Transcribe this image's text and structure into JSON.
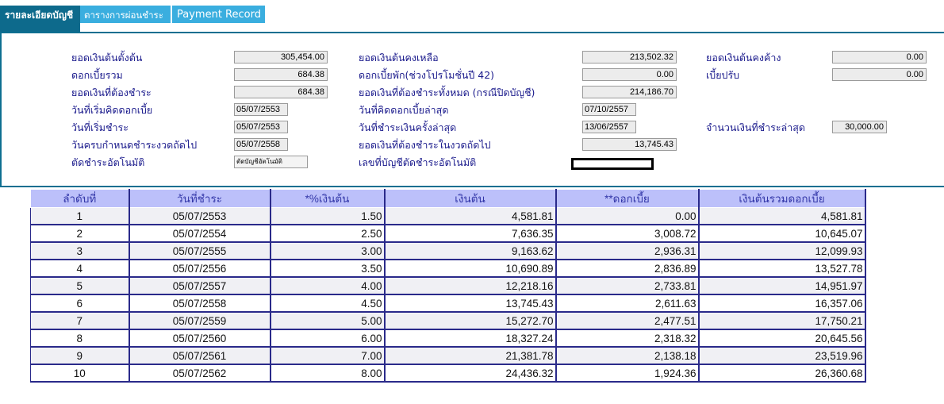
{
  "tabs": [
    {
      "label": "รายละเอียดบัญชี"
    },
    {
      "label": "ตารางการผ่อนชำระ"
    },
    {
      "label": "Payment Record"
    }
  ],
  "details": {
    "principal_start_label": "ยอดเงินต้นตั้งต้น",
    "principal_start_value": "305,454.00",
    "principal_remaining_label": "ยอดเงินต้นคงเหลือ",
    "principal_remaining_value": "213,502.32",
    "principal_overdue_label": "ยอดเงินต้นคงค้าง",
    "principal_overdue_value": "0.00",
    "interest_total_label": "ดอกเบี้ยรวม",
    "interest_total_value": "684.38",
    "interest_suspended_label": "ดอกเบี้ยพัก(ช่วงโปรโมชั่นปี 42)",
    "interest_suspended_value": "0.00",
    "penalty_label": "เบี้ยปรับ",
    "penalty_value": "0.00",
    "amount_due_label": "ยอดเงินที่ต้องชำระ",
    "amount_due_value": "684.38",
    "total_payoff_label": "ยอดเงินที่ต้องชำระทั้งหมด (กรณีปิดบัญชี)",
    "total_payoff_value": "214,186.70",
    "interest_start_date_label": "วันที่เริ่มคิดดอกเบี้ย",
    "interest_start_date_value": "05/07/2553",
    "last_interest_date_label": "วันที่คิดดอกเบี้ยล่าสุด",
    "last_interest_date_value": "07/10/2557",
    "payment_start_date_label": "วันที่เริ่มชำระ",
    "payment_start_date_value": "05/07/2553",
    "last_payment_date_label": "วันที่ชำระเงินครั้งล่าสุด",
    "last_payment_date_value": "13/06/2557",
    "last_payment_amount_label": "จำนวนเงินที่ชำระล่าสุด",
    "last_payment_amount_value": "30,000.00",
    "next_due_date_label": "วันครบกำหนดชำระงวดถัดไป",
    "next_due_date_value": "05/07/2558",
    "next_installment_label": "ยอดเงินที่ต้องชำระในงวดถัดไป",
    "next_installment_value": "13,745.43",
    "auto_debit_label": "ตัดชำระอัตโนมัติ",
    "auto_debit_value": "ตัดบัญชีอัตโนมัติ",
    "auto_debit_account_label": "เลขที่บัญชีตัดชำระอัตโนมัติ"
  },
  "schedule": {
    "headers": [
      "ลำดับที่",
      "วันที่ชำระ",
      "*%เงินต้น",
      "เงินต้น",
      "**ดอกเบี้ย",
      "เงินต้นรวมดอกเบี้ย"
    ],
    "rows": [
      [
        "1",
        "05/07/2553",
        "1.50",
        "4,581.81",
        "0.00",
        "4,581.81"
      ],
      [
        "2",
        "05/07/2554",
        "2.50",
        "7,636.35",
        "3,008.72",
        "10,645.07"
      ],
      [
        "3",
        "05/07/2555",
        "3.00",
        "9,163.62",
        "2,936.31",
        "12,099.93"
      ],
      [
        "4",
        "05/07/2556",
        "3.50",
        "10,690.89",
        "2,836.89",
        "13,527.78"
      ],
      [
        "5",
        "05/07/2557",
        "4.00",
        "12,218.16",
        "2,733.81",
        "14,951.97"
      ],
      [
        "6",
        "05/07/2558",
        "4.50",
        "13,745.43",
        "2,611.63",
        "16,357.06"
      ],
      [
        "7",
        "05/07/2559",
        "5.00",
        "15,272.70",
        "2,477.51",
        "17,750.21"
      ],
      [
        "8",
        "05/07/2560",
        "6.00",
        "18,327.24",
        "2,318.32",
        "20,645.56"
      ],
      [
        "9",
        "05/07/2561",
        "7.00",
        "21,381.78",
        "2,138.18",
        "23,519.96"
      ],
      [
        "10",
        "05/07/2562",
        "8.00",
        "24,436.32",
        "1,924.36",
        "26,360.68"
      ]
    ]
  }
}
